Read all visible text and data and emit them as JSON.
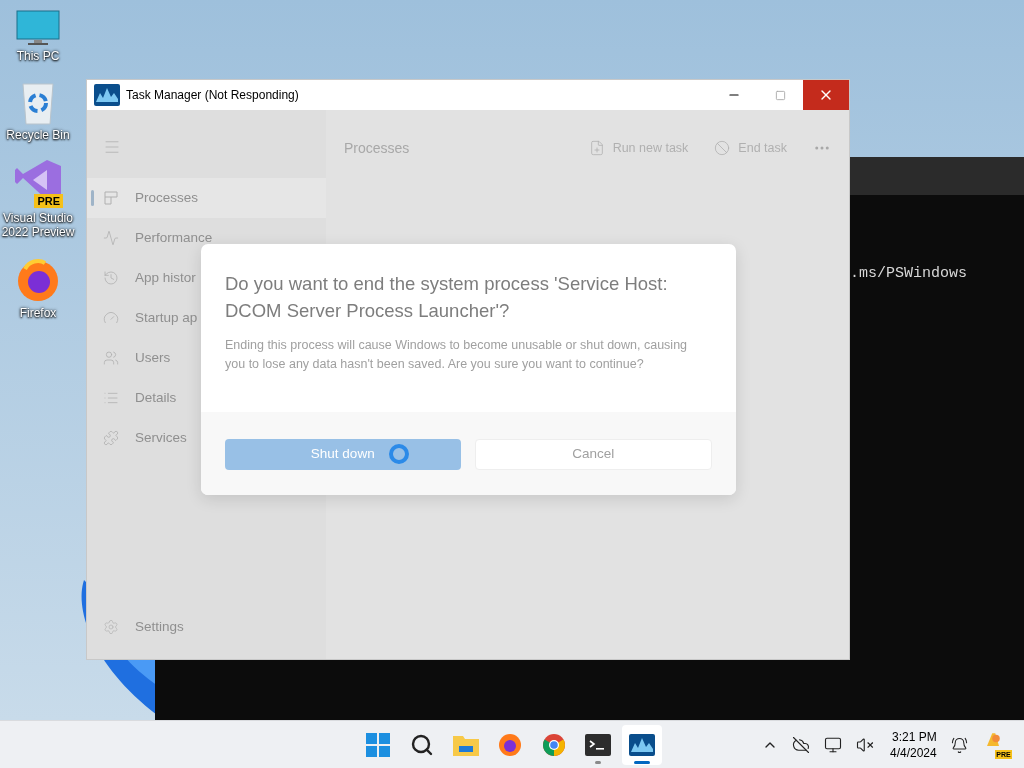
{
  "desktop_icons": [
    {
      "kind": "computer",
      "label": "This PC"
    },
    {
      "kind": "recycle",
      "label": "Recycle Bin"
    },
    {
      "kind": "vs",
      "label": "Visual Studio 2022 Preview",
      "badge": "PRE"
    },
    {
      "kind": "firefox",
      "label": "Firefox"
    }
  ],
  "terminal": {
    "text": ".ms/PSWindows"
  },
  "task_manager": {
    "title": "Task Manager (Not Responding)",
    "sidebar": [
      {
        "label": "Processes",
        "selected": true
      },
      {
        "label": "Performance",
        "selected": false
      },
      {
        "label": "App histor",
        "selected": false
      },
      {
        "label": "Startup ap",
        "selected": false
      },
      {
        "label": "Users",
        "selected": false
      },
      {
        "label": "Details",
        "selected": false
      },
      {
        "label": "Services",
        "selected": false
      }
    ],
    "settings": "Settings",
    "page_title": "Processes",
    "toolbar": [
      {
        "kind": "run",
        "label": "Run new task"
      },
      {
        "kind": "end",
        "label": "End task"
      }
    ],
    "dialog": {
      "title": "Do you want to end the system process 'Service Host: DCOM Server Process Launcher'?",
      "message": "Ending this process will cause Windows to become unusable or shut down, causing you to lose any data hasn't been saved. Are you sure you want to continue?",
      "busy": true,
      "buttons": [
        {
          "kind": "primary",
          "label": "Shut down"
        },
        {
          "kind": "secondary",
          "label": "Cancel"
        }
      ]
    }
  },
  "taskbar": {
    "apps": [
      {
        "kind": "start",
        "running": false,
        "selected": false
      },
      {
        "kind": "search",
        "running": false,
        "selected": false
      },
      {
        "kind": "files",
        "running": false,
        "selected": false
      },
      {
        "kind": "firefox",
        "running": false,
        "selected": false
      },
      {
        "kind": "chrome",
        "running": false,
        "selected": false
      },
      {
        "kind": "terminal",
        "running": true,
        "selected": false
      },
      {
        "kind": "taskmanager",
        "running": true,
        "selected": true
      }
    ],
    "time": "3:21 PM",
    "date": "4/4/2024",
    "copilot_badge": "PRE"
  }
}
